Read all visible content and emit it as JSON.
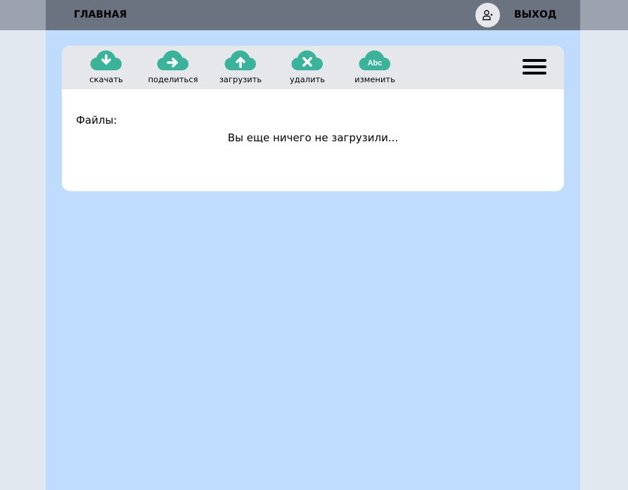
{
  "header": {
    "home": "ГЛАВНАЯ",
    "logout": "ВЫХОД",
    "avatar_icon": "user-icon"
  },
  "toolbar": {
    "items": [
      {
        "label": "скачать",
        "icon": "cloud-download-icon"
      },
      {
        "label": "поделиться",
        "icon": "cloud-share-icon"
      },
      {
        "label": "загрузить",
        "icon": "cloud-upload-icon"
      },
      {
        "label": "удалить",
        "icon": "cloud-delete-icon"
      },
      {
        "label": "изменить",
        "icon": "cloud-rename-icon",
        "glyph": "Abc"
      }
    ],
    "menu_icon": "hamburger-icon"
  },
  "main": {
    "files_label": "Файлы:",
    "empty_message": "Вы еще ничего не загрузили..."
  },
  "colors": {
    "accent": "#3bb39b",
    "header": "#6b7280",
    "background": "#bfdbfe"
  }
}
